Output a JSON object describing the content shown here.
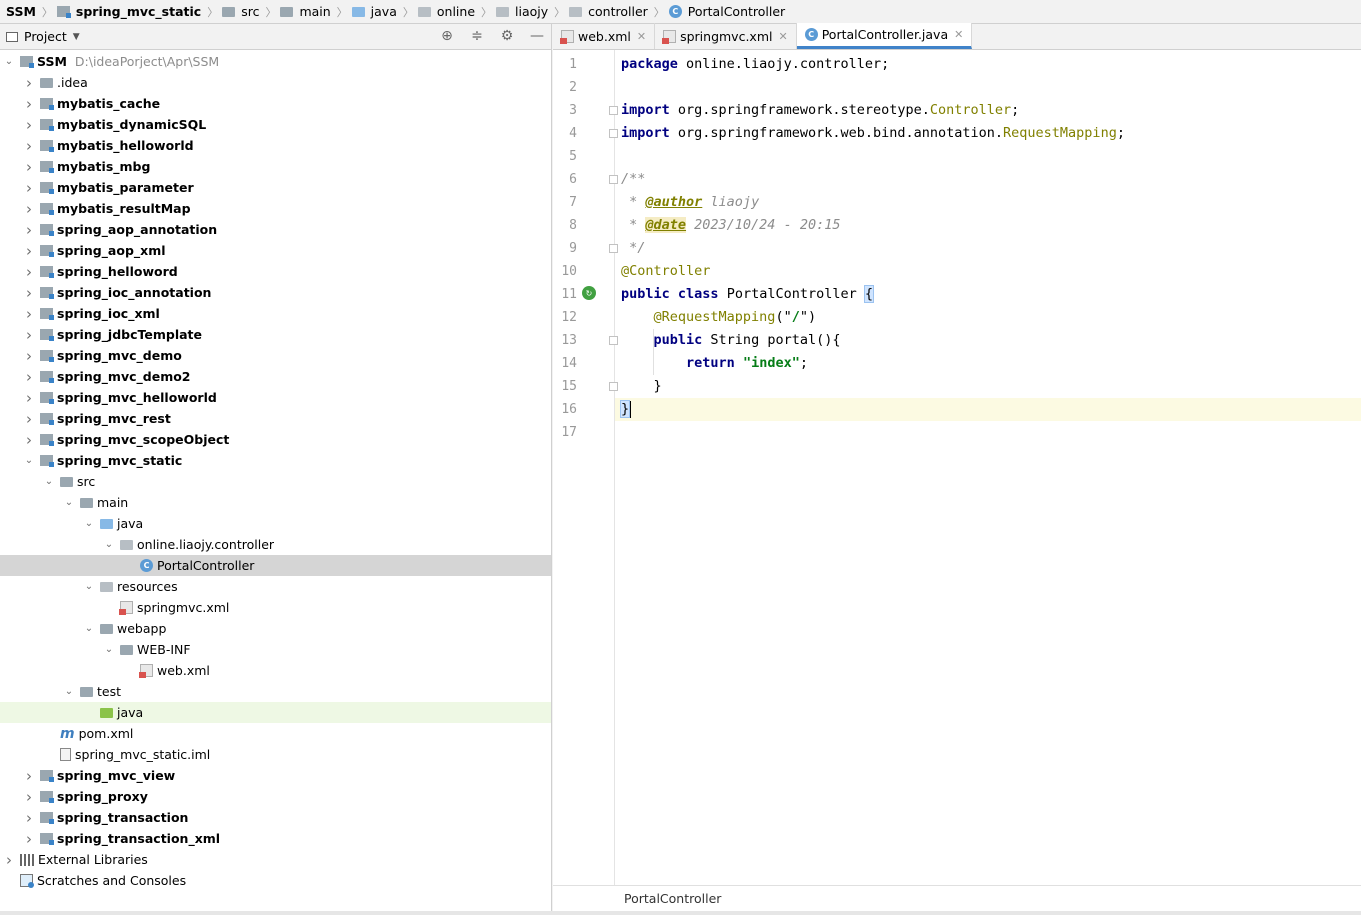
{
  "breadcrumb": [
    {
      "label": "SSM",
      "icon": "none",
      "bold": true
    },
    {
      "label": "spring_mvc_static",
      "icon": "module-icon",
      "bold": true
    },
    {
      "label": "src",
      "icon": "folder-icon"
    },
    {
      "label": "main",
      "icon": "folder-icon"
    },
    {
      "label": "java",
      "icon": "source-folder-icon"
    },
    {
      "label": "online",
      "icon": "package-icon"
    },
    {
      "label": "liaojy",
      "icon": "package-icon"
    },
    {
      "label": "controller",
      "icon": "package-icon"
    },
    {
      "label": "PortalController",
      "icon": "class-icon"
    }
  ],
  "project_panel": {
    "title": "Project",
    "dropdown_glyph": "▼",
    "tool_icons": [
      "locate-icon",
      "collapse-all-icon",
      "settings-icon",
      "hide-icon"
    ]
  },
  "tree": [
    {
      "label": "SSM",
      "hint": "D:\\ideaPorject\\Apr\\SSM",
      "depth": 0,
      "arrow": "down",
      "icon": "module",
      "bold": true
    },
    {
      "label": ".idea",
      "depth": 1,
      "arrow": "right",
      "icon": "folder"
    },
    {
      "label": "mybatis_cache",
      "depth": 1,
      "arrow": "right",
      "icon": "module",
      "bold": true
    },
    {
      "label": "mybatis_dynamicSQL",
      "depth": 1,
      "arrow": "right",
      "icon": "module",
      "bold": true
    },
    {
      "label": "mybatis_helloworld",
      "depth": 1,
      "arrow": "right",
      "icon": "module",
      "bold": true
    },
    {
      "label": "mybatis_mbg",
      "depth": 1,
      "arrow": "right",
      "icon": "module",
      "bold": true
    },
    {
      "label": "mybatis_parameter",
      "depth": 1,
      "arrow": "right",
      "icon": "module",
      "bold": true
    },
    {
      "label": "mybatis_resultMap",
      "depth": 1,
      "arrow": "right",
      "icon": "module",
      "bold": true
    },
    {
      "label": "spring_aop_annotation",
      "depth": 1,
      "arrow": "right",
      "icon": "module",
      "bold": true
    },
    {
      "label": "spring_aop_xml",
      "depth": 1,
      "arrow": "right",
      "icon": "module",
      "bold": true
    },
    {
      "label": "spring_helloword",
      "depth": 1,
      "arrow": "right",
      "icon": "module",
      "bold": true
    },
    {
      "label": "spring_ioc_annotation",
      "depth": 1,
      "arrow": "right",
      "icon": "module",
      "bold": true
    },
    {
      "label": "spring_ioc_xml",
      "depth": 1,
      "arrow": "right",
      "icon": "module",
      "bold": true
    },
    {
      "label": "spring_jdbcTemplate",
      "depth": 1,
      "arrow": "right",
      "icon": "module",
      "bold": true
    },
    {
      "label": "spring_mvc_demo",
      "depth": 1,
      "arrow": "right",
      "icon": "module",
      "bold": true
    },
    {
      "label": "spring_mvc_demo2",
      "depth": 1,
      "arrow": "right",
      "icon": "module",
      "bold": true
    },
    {
      "label": "spring_mvc_helloworld",
      "depth": 1,
      "arrow": "right",
      "icon": "module",
      "bold": true
    },
    {
      "label": "spring_mvc_rest",
      "depth": 1,
      "arrow": "right",
      "icon": "module",
      "bold": true
    },
    {
      "label": "spring_mvc_scopeObject",
      "depth": 1,
      "arrow": "right",
      "icon": "module",
      "bold": true
    },
    {
      "label": "spring_mvc_static",
      "depth": 1,
      "arrow": "down",
      "icon": "module",
      "bold": true
    },
    {
      "label": "src",
      "depth": 2,
      "arrow": "down",
      "icon": "folder"
    },
    {
      "label": "main",
      "depth": 3,
      "arrow": "down",
      "icon": "folder"
    },
    {
      "label": "java",
      "depth": 4,
      "arrow": "down",
      "icon": "source-folder"
    },
    {
      "label": "online.liaojy.controller",
      "depth": 5,
      "arrow": "down",
      "icon": "package"
    },
    {
      "label": "PortalController",
      "depth": 6,
      "arrow": "none",
      "icon": "class",
      "selected": true
    },
    {
      "label": "resources",
      "depth": 4,
      "arrow": "down",
      "icon": "resources-folder"
    },
    {
      "label": "springmvc.xml",
      "depth": 5,
      "arrow": "none",
      "icon": "xml"
    },
    {
      "label": "webapp",
      "depth": 4,
      "arrow": "down",
      "icon": "web-folder"
    },
    {
      "label": "WEB-INF",
      "depth": 5,
      "arrow": "down",
      "icon": "folder"
    },
    {
      "label": "web.xml",
      "depth": 6,
      "arrow": "none",
      "icon": "xml"
    },
    {
      "label": "test",
      "depth": 3,
      "arrow": "down",
      "icon": "folder"
    },
    {
      "label": "java",
      "depth": 4,
      "arrow": "none",
      "icon": "test-folder",
      "highlight": true
    },
    {
      "label": "pom.xml",
      "depth": 2,
      "arrow": "none",
      "icon": "maven"
    },
    {
      "label": "spring_mvc_static.iml",
      "depth": 2,
      "arrow": "none",
      "icon": "iml"
    },
    {
      "label": "spring_mvc_view",
      "depth": 1,
      "arrow": "right",
      "icon": "module",
      "bold": true
    },
    {
      "label": "spring_proxy",
      "depth": 1,
      "arrow": "right",
      "icon": "module",
      "bold": true
    },
    {
      "label": "spring_transaction",
      "depth": 1,
      "arrow": "right",
      "icon": "module",
      "bold": true
    },
    {
      "label": "spring_transaction_xml",
      "depth": 1,
      "arrow": "right",
      "icon": "module",
      "bold": true
    },
    {
      "label": "External Libraries",
      "depth": 0,
      "arrow": "right",
      "icon": "libraries"
    },
    {
      "label": "Scratches and Consoles",
      "depth": 0,
      "arrow": "none",
      "icon": "scratch"
    }
  ],
  "editor": {
    "tabs": [
      {
        "label": "web.xml",
        "icon": "xml",
        "active": false
      },
      {
        "label": "springmvc.xml",
        "icon": "xml",
        "active": false
      },
      {
        "label": "PortalController.java",
        "icon": "class",
        "active": true
      }
    ],
    "close_glyph": "✕",
    "line_numbers": [
      "1",
      "2",
      "3",
      "4",
      "5",
      "6",
      "7",
      "8",
      "9",
      "10",
      "11",
      "12",
      "13",
      "14",
      "15",
      "16",
      "17"
    ],
    "current_line": 16,
    "code_lines": [
      [
        {
          "t": "package",
          "c": "kw"
        },
        {
          "t": " online.liaojy.controller;"
        }
      ],
      [],
      [
        {
          "t": "import",
          "c": "kw"
        },
        {
          "t": " org.springframework.stereotype."
        },
        {
          "t": "Controller",
          "c": "ann"
        },
        {
          "t": ";"
        }
      ],
      [
        {
          "t": "import",
          "c": "kw"
        },
        {
          "t": " org.springframework.web.bind.annotation."
        },
        {
          "t": "RequestMapping",
          "c": "ann"
        },
        {
          "t": ";"
        }
      ],
      [],
      [
        {
          "t": "/**",
          "c": "cmt"
        }
      ],
      [
        {
          "t": " * ",
          "c": "cmt"
        },
        {
          "t": "@author",
          "c": "tag"
        },
        {
          "t": " liaojy",
          "c": "cmt"
        }
      ],
      [
        {
          "t": " * ",
          "c": "cmt"
        },
        {
          "t": "@date",
          "c": "tag hl"
        },
        {
          "t": " 2023/10/24 - 20:15",
          "c": "cmt"
        }
      ],
      [
        {
          "t": " */",
          "c": "cmt"
        }
      ],
      [
        {
          "t": "@Controller",
          "c": "ann"
        }
      ],
      [
        {
          "t": "public",
          "c": "kw"
        },
        {
          "t": " "
        },
        {
          "t": "class",
          "c": "kw"
        },
        {
          "t": " PortalController "
        },
        {
          "t": "{",
          "c": "brace-hl"
        }
      ],
      [
        {
          "t": "    "
        },
        {
          "t": "@RequestMapping",
          "c": "ann"
        },
        {
          "t": "(\""
        },
        {
          "t": "/",
          "c": "str"
        },
        {
          "t": "\")"
        }
      ],
      [
        {
          "t": "    "
        },
        {
          "t": "public",
          "c": "kw"
        },
        {
          "t": " String portal(){"
        }
      ],
      [
        {
          "t": "        "
        },
        {
          "t": "return",
          "c": "kw"
        },
        {
          "t": " "
        },
        {
          "t": "\"index\"",
          "c": "str"
        },
        {
          "t": ";"
        }
      ],
      [
        {
          "t": "    }"
        }
      ],
      [
        {
          "t": "}",
          "c": "brace-hl"
        }
      ],
      []
    ],
    "footer_breadcrumb": "PortalController"
  }
}
